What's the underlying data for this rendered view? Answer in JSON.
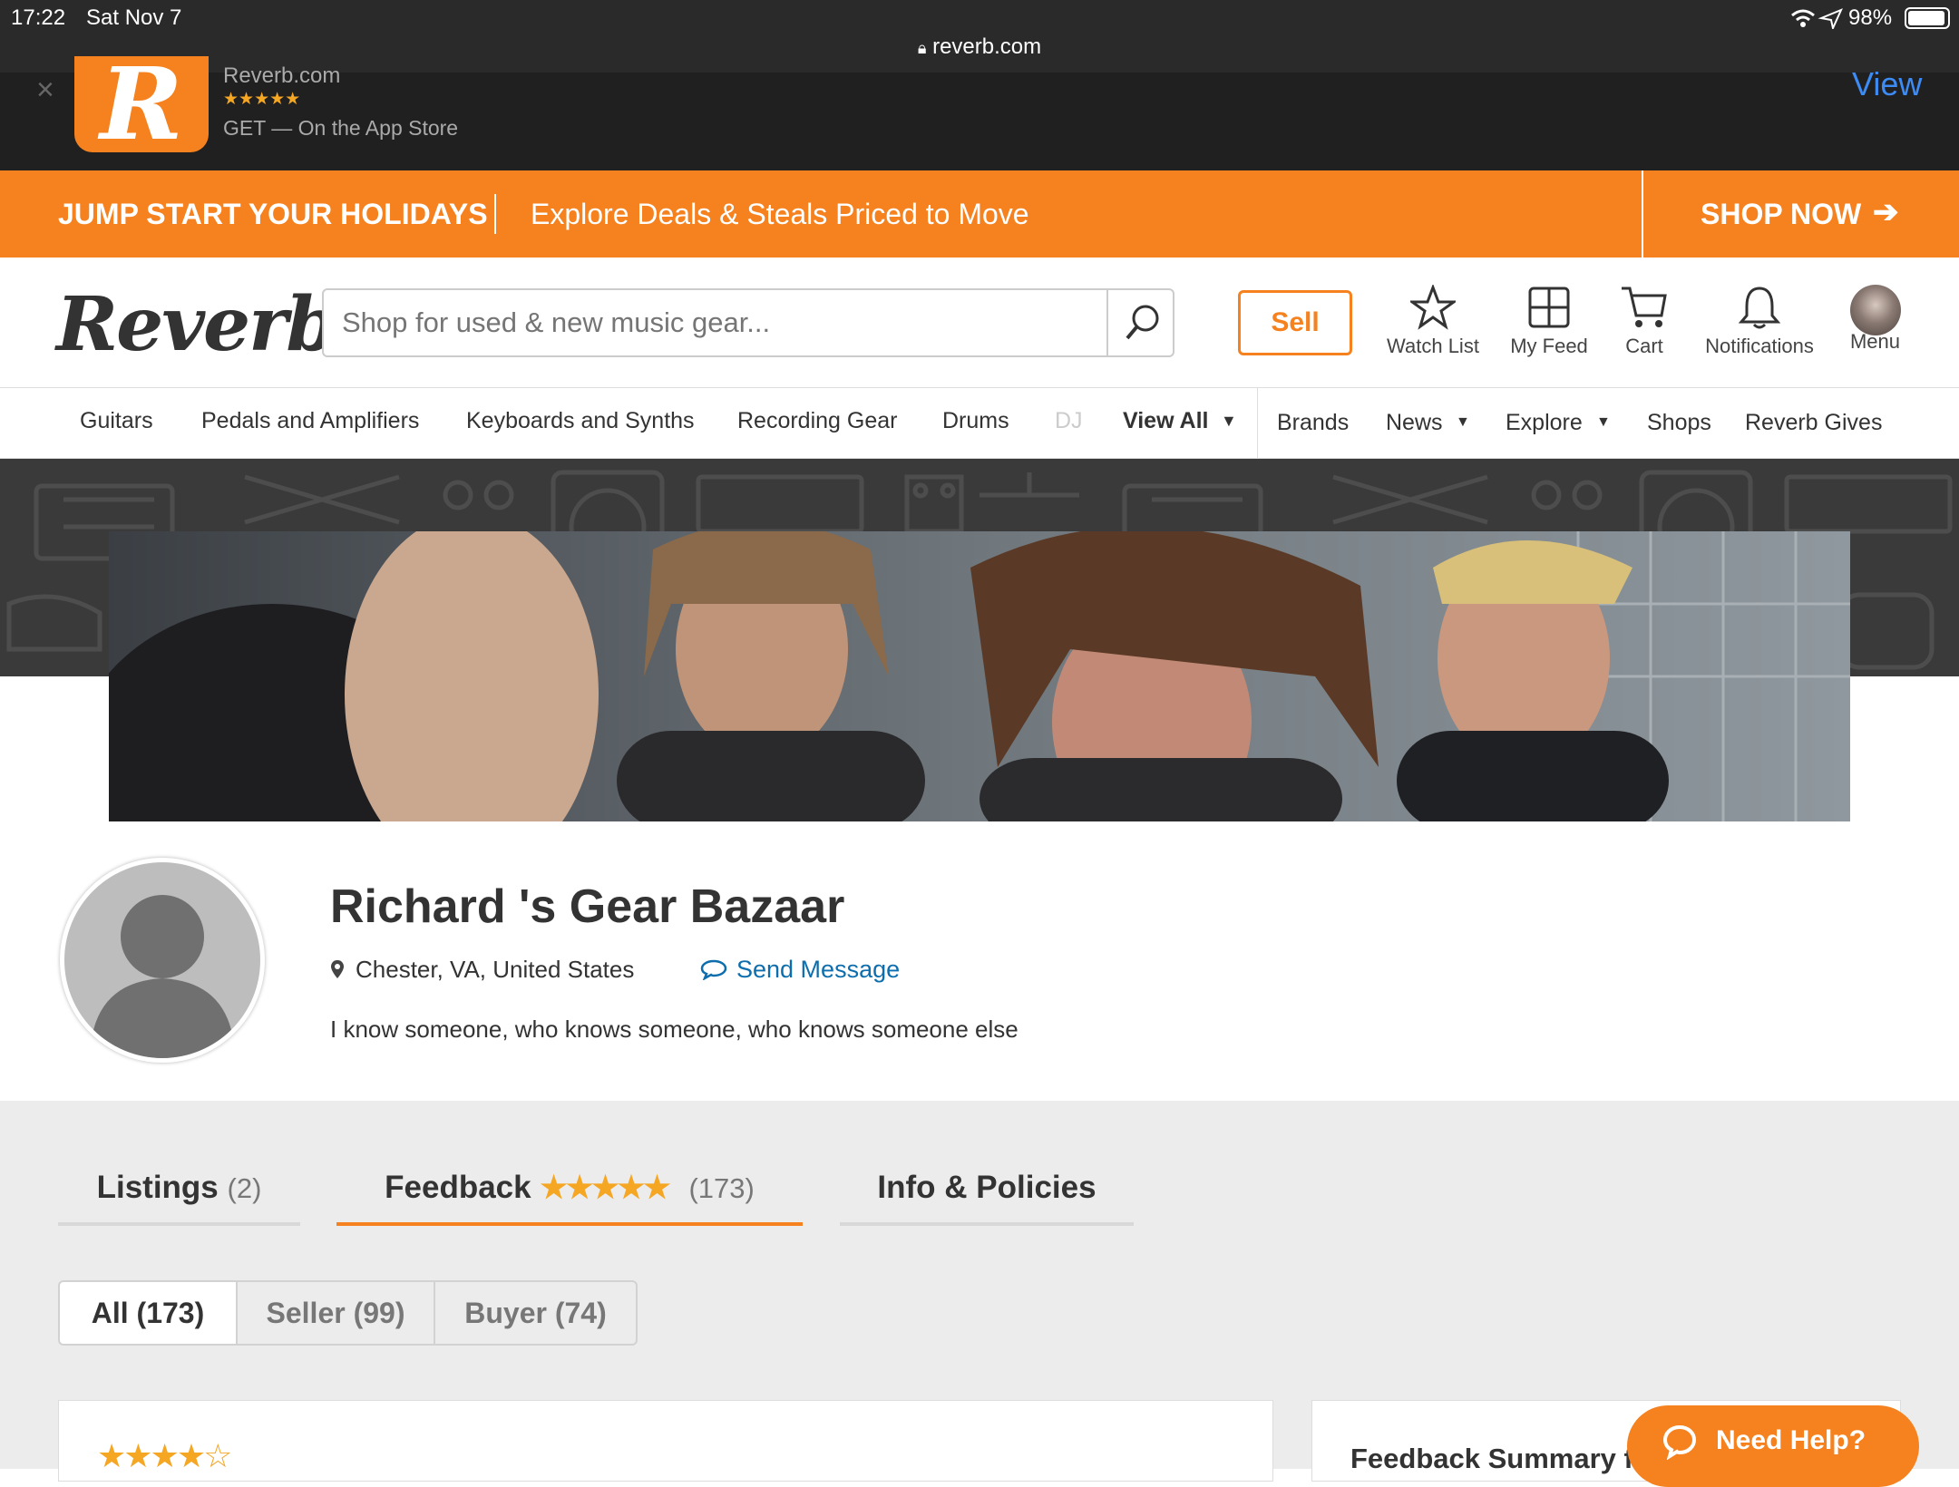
{
  "status_bar": {
    "time": "17:22",
    "date": "Sat Nov 7",
    "battery": "98%",
    "url": "reverb.com"
  },
  "app_banner": {
    "app_name": "Reverb.com",
    "rating": "★★★★★",
    "get_text": "GET — On the App Store",
    "view_label": "View",
    "logo_letter": "R"
  },
  "promo": {
    "headline": "JUMP START YOUR HOLIDAYS",
    "subtext": "Explore Deals & Steals Priced to Move",
    "cta": "SHOP NOW"
  },
  "header": {
    "logo": "Reverb",
    "search_placeholder": "Shop for used & new music gear...",
    "sell_label": "Sell",
    "nav": [
      {
        "label": "Watch List",
        "icon": "star-icon"
      },
      {
        "label": "My Feed",
        "icon": "grid-icon"
      },
      {
        "label": "Cart",
        "icon": "cart-icon"
      },
      {
        "label": "Notifications",
        "icon": "bell-icon"
      },
      {
        "label": "Menu",
        "icon": "avatar"
      }
    ]
  },
  "category_nav": {
    "items": [
      "Guitars",
      "Pedals and Amplifiers",
      "Keyboards and Synths",
      "Recording Gear",
      "Drums",
      "DJ"
    ],
    "view_all": "View All",
    "right_items": [
      "Brands",
      "News",
      "Explore",
      "Shops",
      "Reverb Gives"
    ]
  },
  "profile": {
    "shop_name": "Richard 's Gear Bazaar",
    "location": "Chester, VA, United States",
    "send_message": "Send Message",
    "bio": "I know someone, who knows someone, who knows someone else"
  },
  "tabs": {
    "listings_label": "Listings",
    "listings_count": "(2)",
    "feedback_label": "Feedback",
    "feedback_stars": "★★★★★",
    "feedback_count": "(173)",
    "info_label": "Info & Policies"
  },
  "filters": [
    "All (173)",
    "Seller (99)",
    "Buyer (74)"
  ],
  "feedback_card": {
    "stars": "★★★★☆"
  },
  "summary_card": {
    "title": "Feedback Summary for Richard 's Gear Bazaar"
  },
  "help": {
    "label": "Need Help?"
  },
  "colors": {
    "brand_orange": "#f5821f",
    "link_blue": "#0e6ead",
    "ios_blue": "#3d8bf5"
  }
}
